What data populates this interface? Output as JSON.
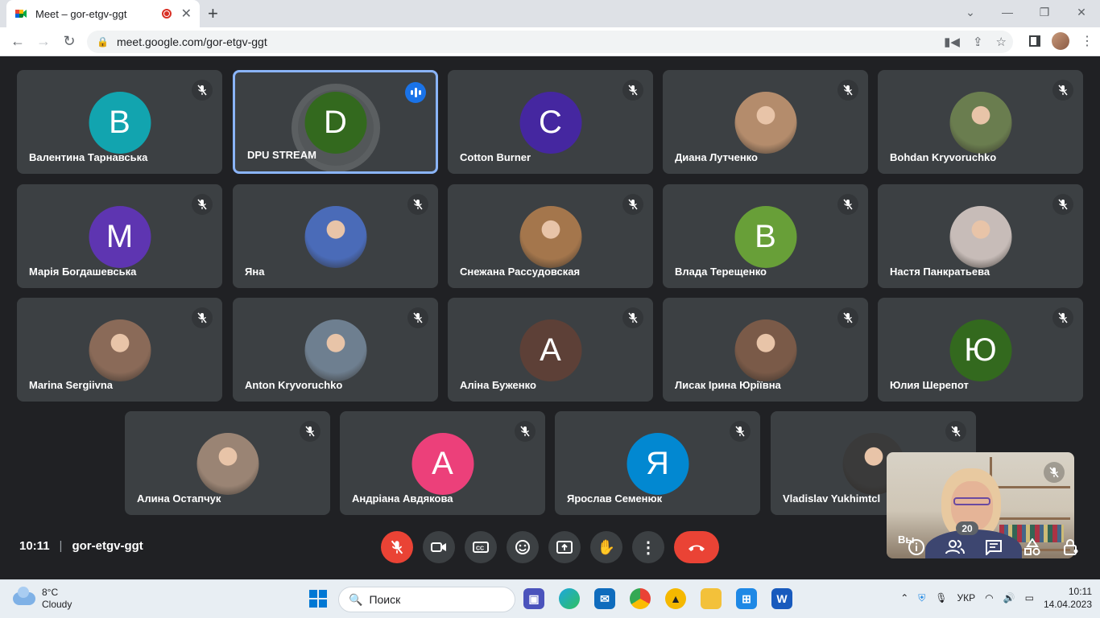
{
  "browser": {
    "tab_title": "Meet – gor-etgv-ggt",
    "url": "meet.google.com/gor-etgv-ggt"
  },
  "tiles": [
    {
      "name": "Валентина Тарнавська",
      "initial": "В",
      "color": "#12a4af"
    },
    {
      "name": "DPU STREAM",
      "initial": "D",
      "color": "#33691e",
      "active": true
    },
    {
      "name": "Cotton Burner",
      "initial": "C",
      "color": "#4527a0"
    },
    {
      "name": "Диана Лутченко",
      "photo": "#b48c6c"
    },
    {
      "name": "Bohdan Kryvoruchko",
      "photo": "#6a7d4f"
    },
    {
      "name": "Марія Богдашевська",
      "initial": "M",
      "color": "#5e35b1"
    },
    {
      "name": "Яна",
      "photo": "#4a6bb8"
    },
    {
      "name": "Снежана Рассудовская",
      "photo": "#a4764c"
    },
    {
      "name": "Влада Терещенко",
      "initial": "B",
      "color": "#689f38"
    },
    {
      "name": "Настя Панкратьева",
      "photo": "#c7bcb8"
    },
    {
      "name": "Marina Sergiivna",
      "photo": "#8a6a58"
    },
    {
      "name": "Anton Kryvoruchko",
      "photo": "#6e7f90"
    },
    {
      "name": "Аліна Буженко",
      "initial": "A",
      "color": "#5d4037"
    },
    {
      "name": "Лисак Ірина Юріївна",
      "photo": "#7a5a48"
    },
    {
      "name": "Юлия Шерепот",
      "initial": "Ю",
      "color": "#33691e"
    },
    {
      "name": "Алина Остапчук",
      "photo": "#9a8474"
    },
    {
      "name": "Андріана Авдякова",
      "initial": "A",
      "color": "#ec407a"
    },
    {
      "name": "Ярослав Семенюк",
      "initial": "Я",
      "color": "#0288d1"
    },
    {
      "name": "Vladislav Yukhimtcl",
      "photo": "#3a3a3a"
    }
  ],
  "self_view": {
    "label": "Вы"
  },
  "meeting": {
    "time": "10:11",
    "code": "gor-etgv-ggt",
    "participants": "20"
  },
  "taskbar": {
    "temp": "8°C",
    "weather": "Cloudy",
    "search": "Поиск",
    "lang": "УКР",
    "time": "10:11",
    "date": "14.04.2023"
  }
}
